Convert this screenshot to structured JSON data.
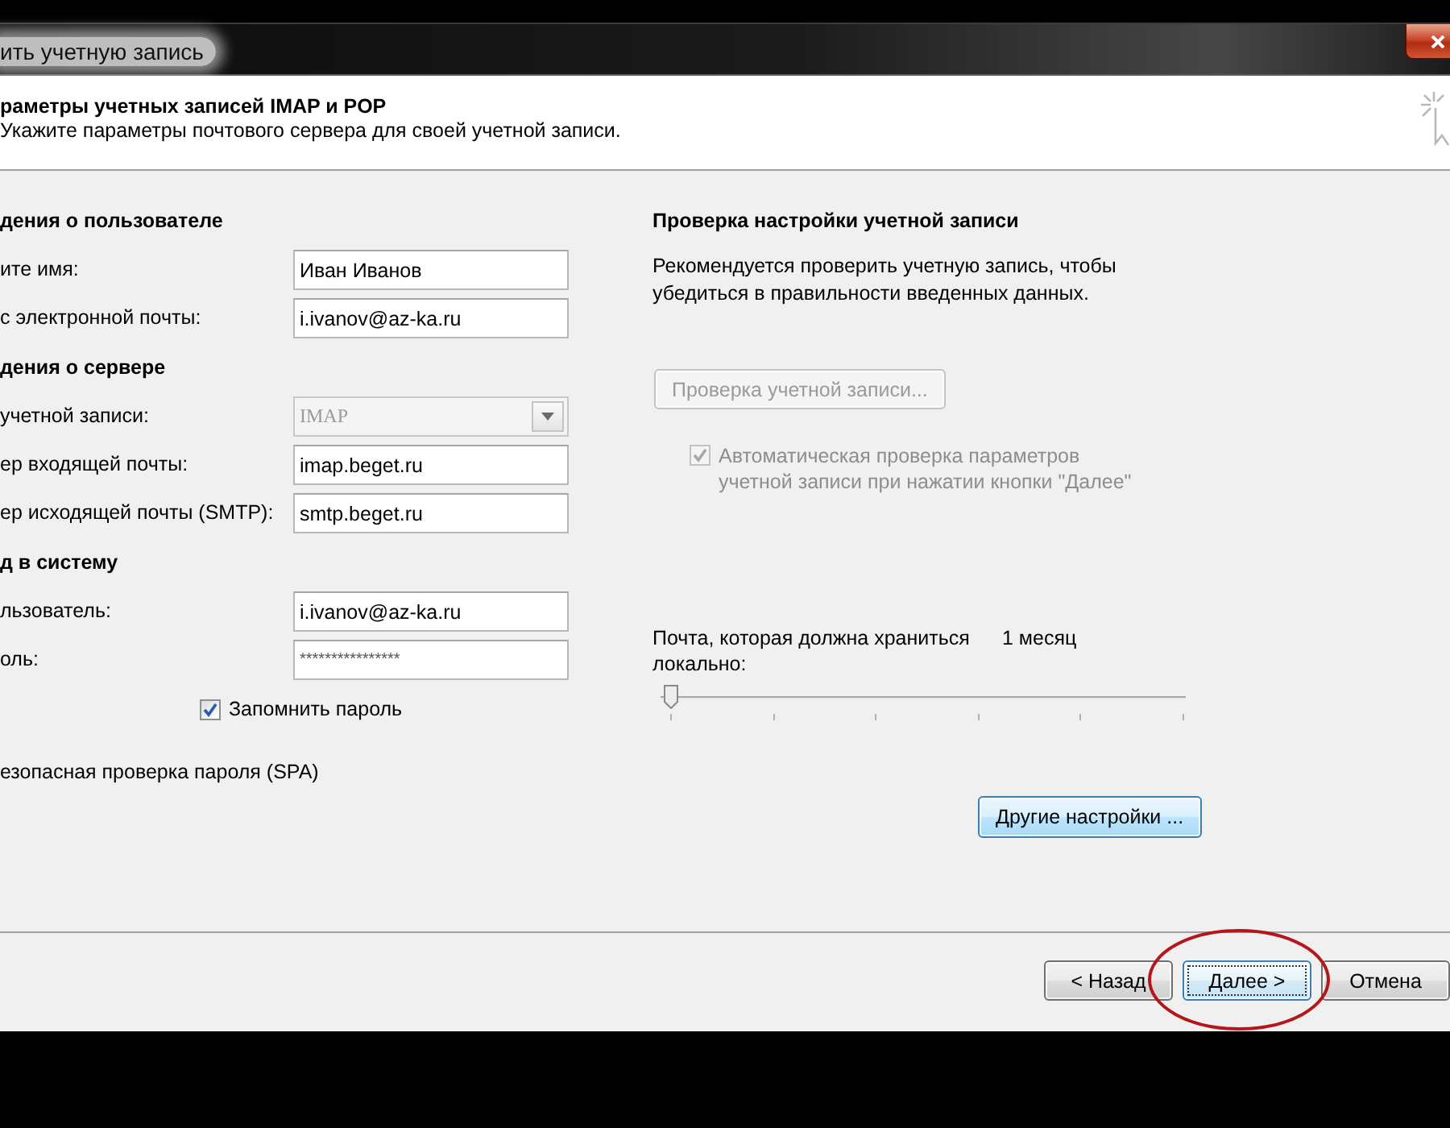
{
  "window": {
    "title": "ить учетную запись"
  },
  "header": {
    "title": "раметры учетных записей IMAP и POP",
    "subtitle": "Укажите параметры почтового сервера для своей учетной записи."
  },
  "sections": [
    {
      "heading": "дения о пользователе",
      "fields": [
        {
          "kind": "text",
          "label": "ите имя:",
          "value": "Иван Иванов",
          "disabled": false
        },
        {
          "kind": "text",
          "label": "с электронной почты:",
          "value": "i.ivanov@az-ka.ru",
          "disabled": false
        }
      ]
    },
    {
      "heading": "дения о сервере",
      "fields": [
        {
          "kind": "dropdown",
          "label": "учетной записи:",
          "value": "IMAP",
          "disabled": true
        },
        {
          "kind": "text",
          "label": "ер входящей почты:",
          "value": "imap.beget.ru",
          "disabled": false
        },
        {
          "kind": "text",
          "label": "ер исходящей почты (SMTP):",
          "value": "smtp.beget.ru",
          "disabled": false
        }
      ]
    },
    {
      "heading": "д в систему",
      "fields": [
        {
          "kind": "text",
          "label": "льзователь:",
          "value": "i.ivanov@az-ka.ru",
          "disabled": false
        },
        {
          "kind": "password",
          "label": "оль:",
          "value": "****************",
          "disabled": false
        }
      ]
    }
  ],
  "remember_password": {
    "label": "Запомнить пароль",
    "checked": true,
    "disabled": false
  },
  "spa": {
    "label": "езопасная проверка пароля (SPA)"
  },
  "test_settings": {
    "heading": "Проверка настройки учетной записи",
    "text": "Рекомендуется проверить учетную запись, чтобы убедиться в правильности введенных данных.",
    "button": {
      "label": "Проверка учетной записи...",
      "disabled": true
    },
    "auto_test": {
      "label_lines": [
        "Автоматическая проверка параметров",
        "учетной записи при нажатии кнопки \"Далее\""
      ],
      "checked": true,
      "disabled": true
    }
  },
  "offline": {
    "label": "Почта, которая должна храниться локально:",
    "reading": "1 месяц",
    "level": 0
  },
  "more_settings": {
    "label": "Другие настройки ...",
    "highlighted": true
  },
  "buttons": [
    {
      "label": "< Назад",
      "focused": false
    },
    {
      "label": "Далее >",
      "focused": true
    },
    {
      "label": "Отмена",
      "focused": false
    }
  ]
}
